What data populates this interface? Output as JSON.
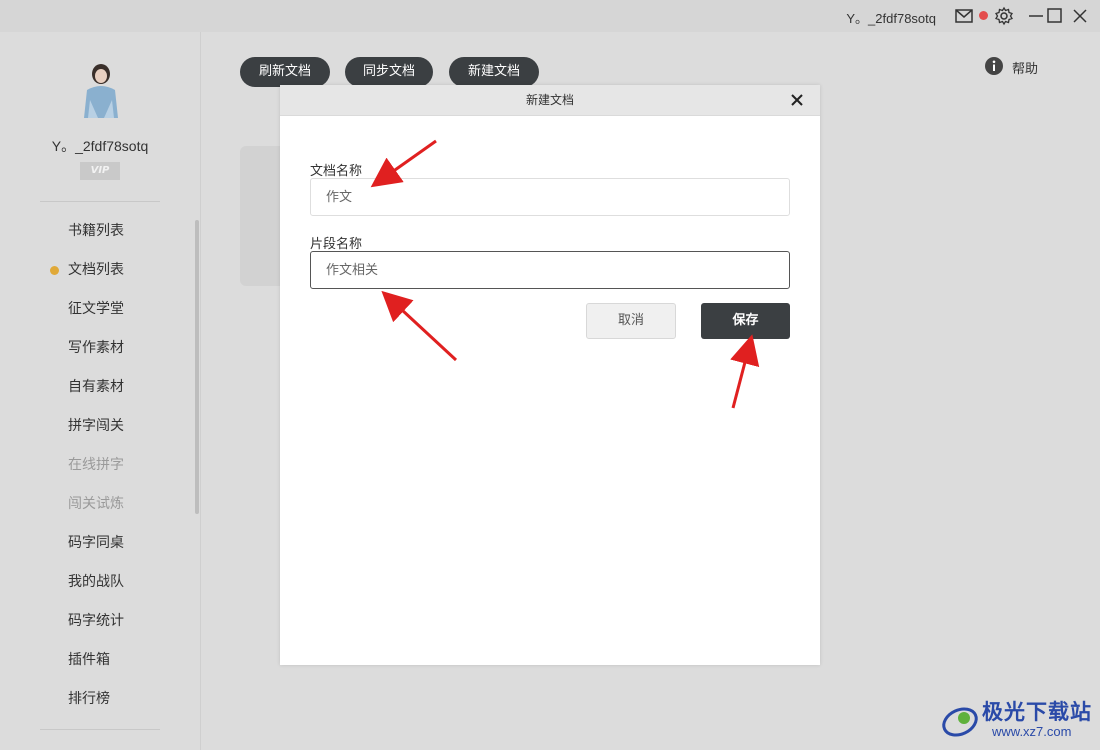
{
  "titlebar": {
    "username": "Y。_2fdf78sotq"
  },
  "sidebar": {
    "username": "Y。_2fdf78sotq",
    "vip_badge": "VIP",
    "items": [
      {
        "label": "书籍列表",
        "active": false,
        "dim": false
      },
      {
        "label": "文档列表",
        "active": true,
        "dim": false
      },
      {
        "label": "征文学堂",
        "active": false,
        "dim": false
      },
      {
        "label": "写作素材",
        "active": false,
        "dim": false
      },
      {
        "label": "自有素材",
        "active": false,
        "dim": false
      },
      {
        "label": "拼字闯关",
        "active": false,
        "dim": false
      },
      {
        "label": "在线拼字",
        "active": false,
        "dim": true
      },
      {
        "label": "闯关试炼",
        "active": false,
        "dim": true
      },
      {
        "label": "码字同桌",
        "active": false,
        "dim": false
      },
      {
        "label": "我的战队",
        "active": false,
        "dim": false
      },
      {
        "label": "码字统计",
        "active": false,
        "dim": false
      },
      {
        "label": "插件箱",
        "active": false,
        "dim": false
      },
      {
        "label": "排行榜",
        "active": false,
        "dim": false
      }
    ]
  },
  "toolbar": {
    "refresh_label": "刷新文档",
    "sync_label": "同步文档",
    "new_label": "新建文档",
    "help_label": "帮助"
  },
  "dialog": {
    "title": "新建文档",
    "doc_name_label": "文档名称",
    "doc_name_value": "作文",
    "segment_name_label": "片段名称",
    "segment_name_value": "作文相关",
    "cancel_label": "取消",
    "save_label": "保存"
  },
  "watermark": {
    "title": "极光下载站",
    "url": "www.xz7.com"
  },
  "colors": {
    "accent_dark": "#3b3f42",
    "active_dot": "#e0a938",
    "notify_dot": "#e34d4d",
    "annotation_arrow": "#e02020"
  }
}
